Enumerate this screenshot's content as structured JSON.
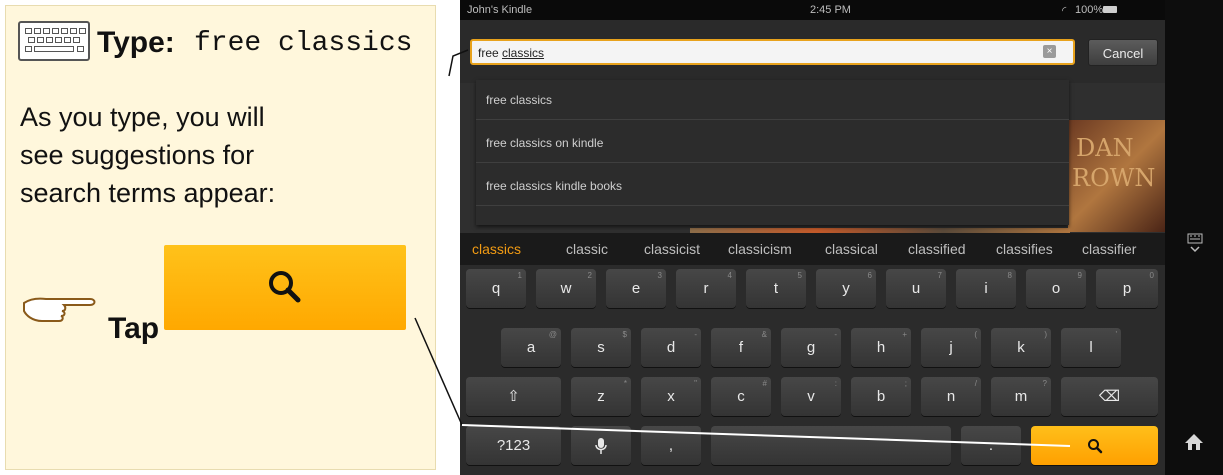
{
  "instruction_panel": {
    "type_label": "Type:",
    "type_value": "free classics",
    "description": "As you type, you will see suggestions for search terms appear:",
    "tap_label": "Tap"
  },
  "device": {
    "status": {
      "owner": "John's Kindle",
      "time": "2:45 PM",
      "battery": "100%"
    },
    "search": {
      "prefix": "free ",
      "typed_word": "classics",
      "cancel": "Cancel",
      "clear": "×"
    },
    "suggestions": [
      "free classics",
      "free classics on kindle",
      "free classics kindle books"
    ],
    "book_title_lines": [
      "DAN",
      "ROWN"
    ],
    "word_suggestions": [
      "classics",
      "classic",
      "classicist",
      "classicism",
      "classical",
      "classified",
      "classifies",
      "classifier"
    ],
    "keyboard": {
      "row1": [
        {
          "k": "q",
          "h": "1"
        },
        {
          "k": "w",
          "h": "2"
        },
        {
          "k": "e",
          "h": "3"
        },
        {
          "k": "r",
          "h": "4"
        },
        {
          "k": "t",
          "h": "5"
        },
        {
          "k": "y",
          "h": "6"
        },
        {
          "k": "u",
          "h": "7"
        },
        {
          "k": "i",
          "h": "8"
        },
        {
          "k": "o",
          "h": "9"
        },
        {
          "k": "p",
          "h": "0"
        }
      ],
      "row2": [
        {
          "k": "a",
          "h": "@"
        },
        {
          "k": "s",
          "h": "$"
        },
        {
          "k": "d",
          "h": "-"
        },
        {
          "k": "f",
          "h": "&"
        },
        {
          "k": "g",
          "h": "-"
        },
        {
          "k": "h",
          "h": "+"
        },
        {
          "k": "j",
          "h": "("
        },
        {
          "k": "k",
          "h": ")"
        },
        {
          "k": "l",
          "h": "'"
        }
      ],
      "row3": [
        {
          "k": "z",
          "h": "*"
        },
        {
          "k": "x",
          "h": "\""
        },
        {
          "k": "c",
          "h": "#"
        },
        {
          "k": "v",
          "h": ":"
        },
        {
          "k": "b",
          "h": ";"
        },
        {
          "k": "n",
          "h": "/"
        },
        {
          "k": "m",
          "h": "?"
        }
      ],
      "shift": "⇧",
      "backspace": "⌫",
      "numbers": "?123",
      "mic": "🎤",
      "comma": ",",
      "period": "."
    }
  },
  "colors": {
    "accent": "#ffa800",
    "panel": "#fff7dc",
    "keyboard": "#2b2b2b"
  },
  "icons": [
    "keyboard-icon",
    "pointing-hand-icon",
    "search-icon",
    "wifi-icon",
    "battery-icon",
    "clear-icon",
    "shift-icon",
    "backspace-icon",
    "mic-icon",
    "home-icon",
    "hide-keyboard-icon"
  ]
}
